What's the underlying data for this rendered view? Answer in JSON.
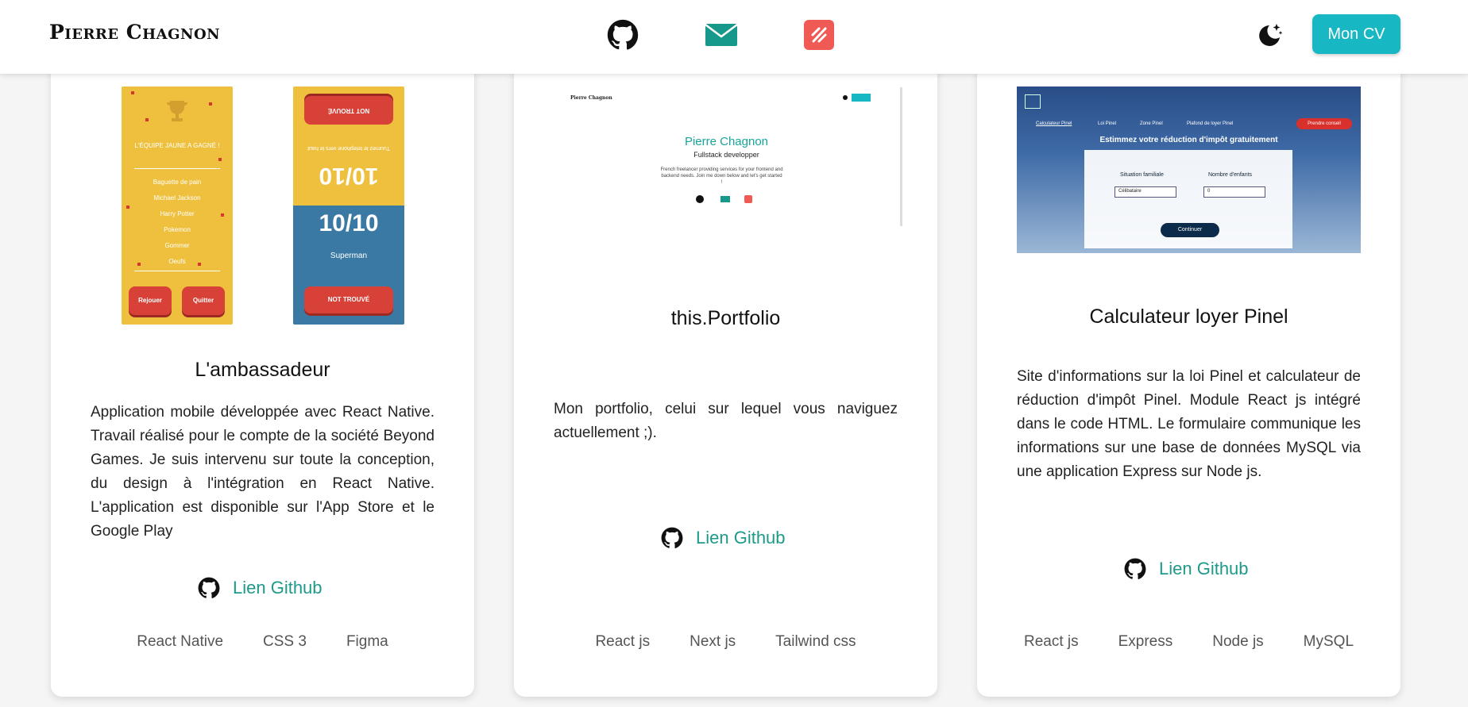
{
  "header": {
    "brand": "Pierre Chagnon",
    "icons": [
      "github-icon",
      "mail-icon",
      "malt-icon"
    ],
    "cv_button": "Mon CV",
    "accent": "#17b8c4"
  },
  "cards": [
    {
      "title": "L'ambassadeur",
      "description": "Application mobile développée avec React Native. Travail réalisé pour le compte de la société Beyond Games. Je suis intervenu sur toute la conception, du design à l'intégration en React Native. L'application est disponible sur l'App Store et le Google Play",
      "link": "Lien Github",
      "tags": [
        "React Native",
        "CSS 3",
        "Figma"
      ],
      "preview": {
        "winner": "L'ÉQUIPE JAUNE A GAGNÉ !",
        "list": [
          "Baguette de pain",
          "Michael Jackson",
          "Harry Potter",
          "Pokemon",
          "Gommer",
          "Oeufs"
        ],
        "btn_replay": "Rejouer",
        "btn_quit": "Quitter",
        "score_top": "10/10",
        "score_bottom": "10/10",
        "word": "Superman",
        "not_found": "NOT TROUVÉ"
      }
    },
    {
      "title": "this.Portfolio",
      "description": "Mon portfolio, celui sur lequel vous naviguez actuellement ;).",
      "link": "Lien Github",
      "tags": [
        "React js",
        "Next js",
        "Tailwind css"
      ],
      "preview": {
        "brand": "Pierre Chagnon",
        "name": "Pierre Chagnon",
        "role": "Fullstack developper",
        "tagline": "French freelancer providing services for your frontend and backend needs. Join me down below and let's get started !"
      }
    },
    {
      "title": "Calculateur loyer Pinel",
      "description": "Site d'informations sur la loi Pinel et calculateur de réduction d'impôt Pinel. Module React js intégré dans le code HTML. Le formulaire communique les informations sur une base de données MySQL via une application Express sur Node js.",
      "link": "Lien Github",
      "tags": [
        "React js",
        "Express",
        "Node js",
        "MySQL"
      ],
      "preview": {
        "nav": [
          "Calculateur Pinel",
          "Loi Pinel",
          "Zone Pinel",
          "Plafond de loyer Pinel"
        ],
        "cta": "Prendre conseil",
        "heading": "Estimmez votre réduction d'impôt gratuitement",
        "field1_label": "Situation familiale",
        "field1_value": "Célibataire",
        "field2_label": "Nombre d'enfants",
        "field2_value": "0",
        "continue": "Continuer"
      }
    }
  ]
}
